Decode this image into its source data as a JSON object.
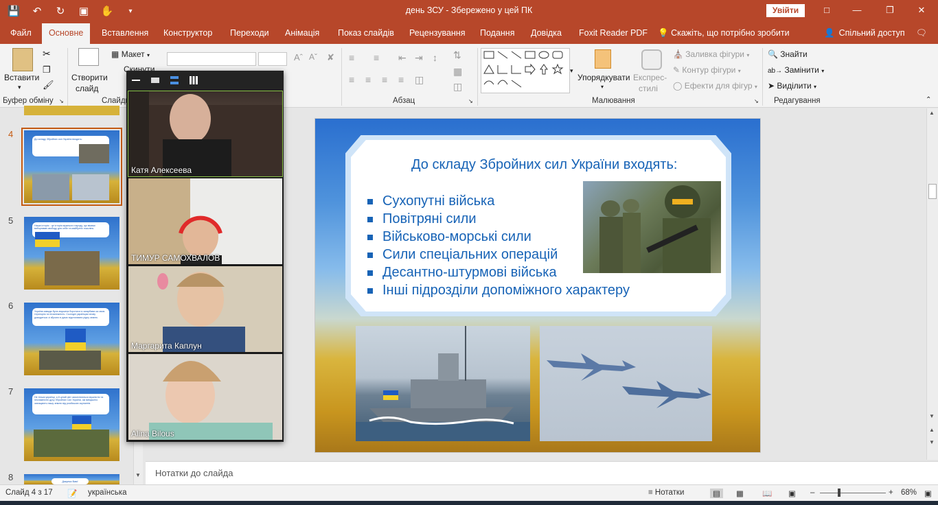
{
  "window": {
    "title": "день ЗСУ  -  Збережено у цей ПК",
    "sign_in": "Увійти"
  },
  "tabs": [
    "Файл",
    "Основне",
    "Вставлення",
    "Конструктор",
    "Переходи",
    "Анімація",
    "Показ слайдів",
    "Рецензування",
    "Подання",
    "Довідка",
    "Foxit Reader PDF",
    "Скажіть, що потрібно зробити"
  ],
  "share": "Спільний доступ",
  "ribbon": {
    "paste": "Вставити",
    "clipboard_group": "Буфер обміну",
    "new_slide_1": "Створити",
    "new_slide_2": "слайд",
    "slides_group": "Слайди",
    "layout": "Макет",
    "reset": "Скинути",
    "paragraph_group": "Абзац",
    "arrange": "Упорядкувати",
    "quick_styles_1": "Експрес-",
    "quick_styles_2": "стилі",
    "shape_fill": "Заливка фігури",
    "shape_outline": "Контур фігури",
    "shape_effects": "Ефекти для фігур",
    "drawing_group": "Малювання",
    "find": "Знайти",
    "replace": "Замінити",
    "select": "Виділити",
    "editing_group": "Редагування"
  },
  "thumbnails": [
    {
      "num": "4",
      "text": "До складу Збройних сил України входять:"
    },
    {
      "num": "5",
      "text": "Наша історія - це історія мужнього народу, що віками виборював свободу для себе та майбутніх поколінь."
    },
    {
      "num": "6",
      "text": "Україна завжди була змушена боротися із загарбами за свою територію та незалежність. Сьогодні українцям знову доводиться зі зброєю в руках відстоювати рідну землю."
    },
    {
      "num": "7",
      "text": "Не тільки українці, а й цілий світ захоплюються мужністю та незламністю духу Збройних Сил України, які вимушено захищають нашу землю від російських окупантів."
    },
    {
      "num": "8",
      "text": "Дякуємо Вам!"
    }
  ],
  "slide": {
    "title": "До складу Збройних сил України входять:",
    "bullets": [
      "Сухопутні війська",
      "Повітряні сили",
      "Військово-морські сили",
      "Сили спеціальних операцій",
      "Десантно-штурмові війська",
      "Інші підрозділи допоміжного характеру"
    ]
  },
  "notes_placeholder": "Нотатки до слайда",
  "status": {
    "slide_counter": "Слайд 4 з 17",
    "language": "українська",
    "notes_btn": "Нотатки",
    "zoom": "68%"
  },
  "video": {
    "participants": [
      "Катя Алексеева",
      "ТИМУР  САМОХВАЛОВ",
      "Маргарита Каплун",
      "Alina Bilous"
    ]
  },
  "colors": {
    "accent": "#b7472a",
    "slide_text": "#1763b6",
    "selection": "#c55a11"
  }
}
